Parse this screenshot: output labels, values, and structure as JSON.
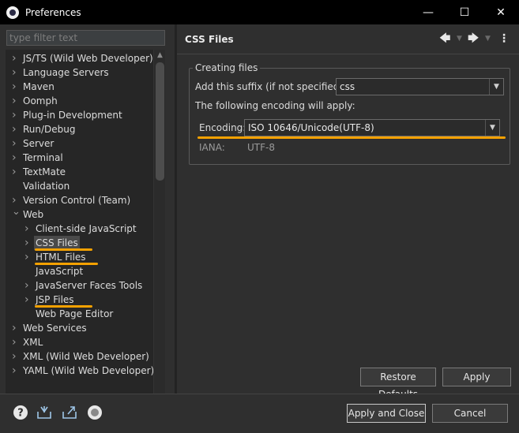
{
  "window": {
    "title": "Preferences",
    "minimize_glyph": "—",
    "maximize_glyph": "☐",
    "close_glyph": "✕"
  },
  "left": {
    "filter_placeholder": "type filter text",
    "tree": [
      {
        "label": "JS/TS (Wild Web Developer)",
        "level": 0,
        "expander": "collapsed"
      },
      {
        "label": "Language Servers",
        "level": 0,
        "expander": "collapsed"
      },
      {
        "label": "Maven",
        "level": 0,
        "expander": "collapsed"
      },
      {
        "label": "Oomph",
        "level": 0,
        "expander": "collapsed"
      },
      {
        "label": "Plug-in Development",
        "level": 0,
        "expander": "collapsed"
      },
      {
        "label": "Run/Debug",
        "level": 0,
        "expander": "collapsed"
      },
      {
        "label": "Server",
        "level": 0,
        "expander": "collapsed"
      },
      {
        "label": "Terminal",
        "level": 0,
        "expander": "collapsed"
      },
      {
        "label": "TextMate",
        "level": 0,
        "expander": "collapsed"
      },
      {
        "label": "Validation",
        "level": 0,
        "expander": "none"
      },
      {
        "label": "Version Control (Team)",
        "level": 0,
        "expander": "collapsed"
      },
      {
        "label": "Web",
        "level": 0,
        "expander": "expanded"
      },
      {
        "label": "Client-side JavaScript",
        "level": 1,
        "expander": "collapsed"
      },
      {
        "label": "CSS Files",
        "level": 1,
        "expander": "collapsed",
        "selected": true,
        "highlight": true
      },
      {
        "label": "HTML Files",
        "level": 1,
        "expander": "collapsed",
        "highlight": true
      },
      {
        "label": "JavaScript",
        "level": 1,
        "expander": "none"
      },
      {
        "label": "JavaServer Faces Tools",
        "level": 1,
        "expander": "collapsed"
      },
      {
        "label": "JSP Files",
        "level": 1,
        "expander": "collapsed",
        "highlight": true
      },
      {
        "label": "Web Page Editor",
        "level": 1,
        "expander": "none"
      },
      {
        "label": "Web Services",
        "level": 0,
        "expander": "collapsed"
      },
      {
        "label": "XML",
        "level": 0,
        "expander": "collapsed"
      },
      {
        "label": "XML (Wild Web Developer)",
        "level": 0,
        "expander": "collapsed"
      },
      {
        "label": "YAML (Wild Web Developer)",
        "level": 0,
        "expander": "collapsed"
      }
    ]
  },
  "right": {
    "page_title": "CSS Files",
    "group_label": "Creating files",
    "suffix_label": "Add this suffix (if not specified):",
    "suffix_value": "css",
    "encoding_note": "The following encoding will apply:",
    "encoding_label": "Encoding:",
    "encoding_value": "ISO 10646/Unicode(UTF-8)",
    "iana_label": "IANA:",
    "iana_value": "UTF-8",
    "restore_button": "Restore Defaults",
    "apply_button": "Apply"
  },
  "bottom": {
    "apply_close_button": "Apply and Close",
    "cancel_button": "Cancel"
  },
  "colors": {
    "accent_underline": "#f5a100",
    "background": "#2f2f2f",
    "titlebar": "#000000"
  }
}
